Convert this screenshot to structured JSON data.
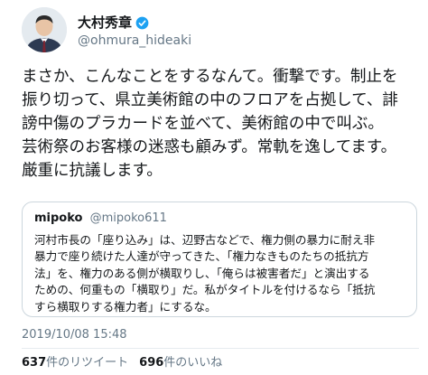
{
  "tweet": {
    "author_name": "大村秀章",
    "author_handle": "@ohmura_hideaki",
    "text": "まさか、こんなことをするなんて。衝撃です。制止を\n振り切って、県立美術館の中のフロアを占拠して、誹\n謗中傷のプラカードを並べて、美術館の中で叫ぶ。\n芸術祭のお客様の迷惑も顧みず。常軌を逸してます。\n厳重に抗議します。",
    "timestamp": "2019/10/08 15:48",
    "retweet_count": "637",
    "retweet_label": "件のリツイート",
    "like_count": "696",
    "like_label": "件のいいね"
  },
  "quoted_tweet": {
    "author_name": "mipoko",
    "author_handle": "@mipoko611",
    "text": "河村市長の「座り込み」は、辺野古などで、権力側の暴力に耐え非\n暴力で座り続けた人達が守ってきた、「権力なきものたちの抵抗方\n法」を、権力のある側が横取りし、「俺らは被害者だ」と演出する\nための、何重もの「横取り」だ。私がタイトルを付けるなら「抵抗\nすら横取りする権力者」にするな。"
  },
  "icons": {
    "verified": "verified-badge-icon",
    "avatar": "profile-photo"
  },
  "colors": {
    "verified_blue": "#1da1f2",
    "secondary_text": "#657786",
    "border": "#ccd6dd"
  }
}
